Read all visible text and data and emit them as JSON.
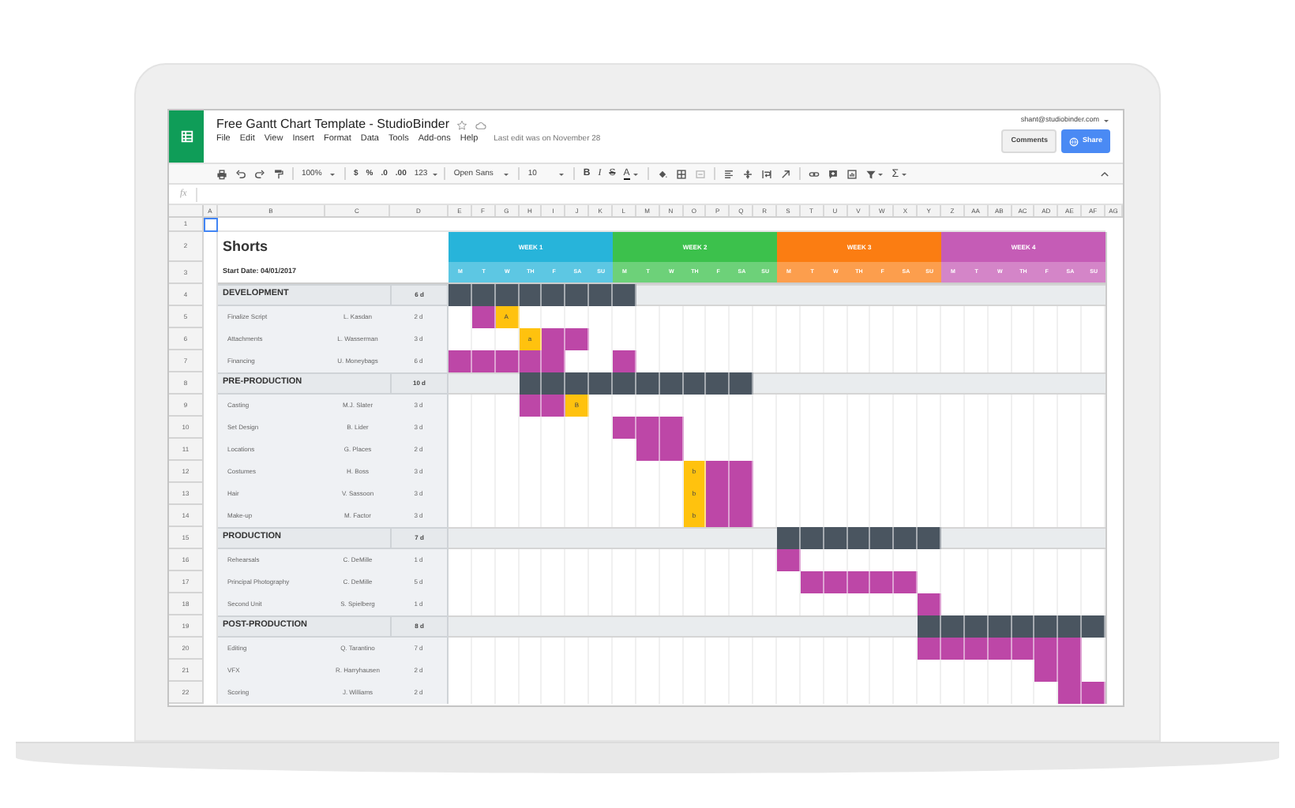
{
  "window": {
    "title": "Free Gantt Chart Template - StudioBinder",
    "account": "shant@studiobinder.com",
    "last_edit": "Last edit was on November 28"
  },
  "menu": [
    "File",
    "Edit",
    "View",
    "Insert",
    "Format",
    "Data",
    "Tools",
    "Add-ons",
    "Help"
  ],
  "buttons": {
    "comments": "Comments",
    "share": "Share"
  },
  "toolbar": {
    "zoom": "100%",
    "currency": "$",
    "percent": "%",
    "decimal_less": ".0",
    "decimal_more": ".00",
    "number_format": "123",
    "font": "Open Sans",
    "font_size": "10",
    "bold": "B",
    "italic": "I",
    "strikethrough": "S",
    "text_color": "A",
    "functions": "Σ"
  },
  "formula_bar": {
    "label": "fx"
  },
  "columns": [
    "A",
    "B",
    "C",
    "D",
    "E",
    "F",
    "G",
    "H",
    "I",
    "J",
    "K",
    "L",
    "M",
    "N",
    "O",
    "P",
    "Q",
    "R",
    "S",
    "T",
    "U",
    "V",
    "W",
    "X",
    "Y",
    "Z",
    "AA",
    "AB",
    "AC",
    "AD",
    "AE",
    "AF",
    "AG"
  ],
  "timeline": {
    "weeks": [
      {
        "label": "WEEK 1",
        "color": "#27b4da",
        "days": [
          "M",
          "T",
          "W",
          "TH",
          "F",
          "SA",
          "SU"
        ]
      },
      {
        "label": "WEEK 2",
        "color": "#3cc14c",
        "days": [
          "M",
          "T",
          "W",
          "TH",
          "F",
          "SA",
          "SU"
        ]
      },
      {
        "label": "WEEK 3",
        "color": "#fb7d12",
        "days": [
          "M",
          "T",
          "W",
          "TH",
          "F",
          "SA",
          "SU"
        ]
      },
      {
        "label": "WEEK 4",
        "color": "#c55cb6",
        "days": [
          "M",
          "T",
          "W",
          "TH",
          "F",
          "SA",
          "SU"
        ]
      }
    ]
  },
  "rows": [
    {
      "number": "1",
      "kind": "blank",
      "cell_selected": true
    },
    {
      "number": "2",
      "kind": "title",
      "text": "Shorts"
    },
    {
      "number": "3",
      "kind": "subtitle",
      "text": "Start Date: 04/01/2017"
    },
    {
      "number": "4",
      "kind": "phase",
      "name": "DEVELOPMENT",
      "duration": "6 d",
      "days": [
        true,
        true,
        true,
        true,
        true,
        true,
        true,
        true,
        false,
        false,
        false,
        false,
        false,
        false,
        false,
        false,
        false,
        false,
        false,
        false,
        false,
        false,
        false,
        false,
        false,
        false,
        false,
        false
      ]
    },
    {
      "number": "5",
      "kind": "task",
      "name": "Finalize Script",
      "owner": "L. Kasdan",
      "duration": "2 d",
      "days": [
        false,
        true,
        {
          "kind": "milestone",
          "label": "A"
        },
        false,
        false,
        false,
        false,
        false,
        false,
        false,
        false,
        false,
        false,
        false,
        false,
        false,
        false,
        false,
        false,
        false,
        false,
        false,
        false,
        false,
        false,
        false,
        false,
        false
      ]
    },
    {
      "number": "6",
      "kind": "task",
      "name": "Attachments",
      "owner": "L. Wasserman",
      "duration": "3 d",
      "days": [
        false,
        false,
        false,
        {
          "kind": "milestone",
          "label": "a"
        },
        true,
        true,
        false,
        false,
        false,
        false,
        false,
        false,
        false,
        false,
        false,
        false,
        false,
        false,
        false,
        false,
        false,
        false,
        false,
        false,
        false,
        false,
        false,
        false
      ]
    },
    {
      "number": "7",
      "kind": "task",
      "name": "Financing",
      "owner": "U. Moneybags",
      "duration": "6 d",
      "days": [
        true,
        true,
        true,
        true,
        true,
        false,
        false,
        true,
        false,
        false,
        false,
        false,
        false,
        false,
        false,
        false,
        false,
        false,
        false,
        false,
        false,
        false,
        false,
        false,
        false,
        false,
        false,
        false
      ]
    },
    {
      "number": "8",
      "kind": "phase",
      "name": "PRE-PRODUCTION",
      "duration": "10 d",
      "days": [
        false,
        false,
        false,
        true,
        true,
        true,
        true,
        true,
        true,
        true,
        true,
        true,
        true,
        false,
        false,
        false,
        false,
        false,
        false,
        false,
        false,
        false,
        false,
        false,
        false,
        false,
        false,
        false
      ]
    },
    {
      "number": "9",
      "kind": "task",
      "name": "Casting",
      "owner": "M.J. Slater",
      "duration": "3 d",
      "days": [
        false,
        false,
        false,
        true,
        true,
        {
          "kind": "milestone",
          "label": "B"
        },
        false,
        false,
        false,
        false,
        false,
        false,
        false,
        false,
        false,
        false,
        false,
        false,
        false,
        false,
        false,
        false,
        false,
        false,
        false,
        false,
        false,
        false
      ]
    },
    {
      "number": "10",
      "kind": "task",
      "name": "Set Design",
      "owner": "B. Lider",
      "duration": "3 d",
      "days": [
        false,
        false,
        false,
        false,
        false,
        false,
        false,
        true,
        true,
        true,
        false,
        false,
        false,
        false,
        false,
        false,
        false,
        false,
        false,
        false,
        false,
        false,
        false,
        false,
        false,
        false,
        false,
        false
      ]
    },
    {
      "number": "11",
      "kind": "task",
      "name": "Locations",
      "owner": "G. Places",
      "duration": "2 d",
      "days": [
        false,
        false,
        false,
        false,
        false,
        false,
        false,
        false,
        true,
        true,
        false,
        false,
        false,
        false,
        false,
        false,
        false,
        false,
        false,
        false,
        false,
        false,
        false,
        false,
        false,
        false,
        false,
        false
      ]
    },
    {
      "number": "12",
      "kind": "task",
      "name": "Costumes",
      "owner": "H. Boss",
      "duration": "3 d",
      "days": [
        false,
        false,
        false,
        false,
        false,
        false,
        false,
        false,
        false,
        false,
        {
          "kind": "milestone",
          "label": "b"
        },
        true,
        true,
        false,
        false,
        false,
        false,
        false,
        false,
        false,
        false,
        false,
        false,
        false,
        false,
        false,
        false,
        false
      ]
    },
    {
      "number": "13",
      "kind": "task",
      "name": "Hair",
      "owner": "V. Sassoon",
      "duration": "3 d",
      "days": [
        false,
        false,
        false,
        false,
        false,
        false,
        false,
        false,
        false,
        false,
        {
          "kind": "milestone",
          "label": "b"
        },
        true,
        true,
        false,
        false,
        false,
        false,
        false,
        false,
        false,
        false,
        false,
        false,
        false,
        false,
        false,
        false,
        false
      ]
    },
    {
      "number": "14",
      "kind": "task",
      "name": "Make-up",
      "owner": "M. Factor",
      "duration": "3 d",
      "days": [
        false,
        false,
        false,
        false,
        false,
        false,
        false,
        false,
        false,
        false,
        {
          "kind": "milestone",
          "label": "b"
        },
        true,
        true,
        false,
        false,
        false,
        false,
        false,
        false,
        false,
        false,
        false,
        false,
        false,
        false,
        false,
        false,
        false
      ]
    },
    {
      "number": "15",
      "kind": "phase",
      "name": "PRODUCTION",
      "duration": "7 d",
      "days": [
        false,
        false,
        false,
        false,
        false,
        false,
        false,
        false,
        false,
        false,
        false,
        false,
        false,
        false,
        true,
        true,
        true,
        true,
        true,
        true,
        true,
        false,
        false,
        false,
        false,
        false,
        false,
        false
      ]
    },
    {
      "number": "16",
      "kind": "task",
      "name": "Rehearsals",
      "owner": "C. DeMille",
      "duration": "1 d",
      "days": [
        false,
        false,
        false,
        false,
        false,
        false,
        false,
        false,
        false,
        false,
        false,
        false,
        false,
        false,
        true,
        false,
        false,
        false,
        false,
        false,
        false,
        false,
        false,
        false,
        false,
        false,
        false,
        false
      ]
    },
    {
      "number": "17",
      "kind": "task",
      "name": "Principal Photography",
      "owner": "C. DeMille",
      "duration": "5 d",
      "days": [
        false,
        false,
        false,
        false,
        false,
        false,
        false,
        false,
        false,
        false,
        false,
        false,
        false,
        false,
        false,
        true,
        true,
        true,
        true,
        true,
        false,
        false,
        false,
        false,
        false,
        false,
        false,
        false
      ]
    },
    {
      "number": "18",
      "kind": "task",
      "name": "Second Unit",
      "owner": "S. Spielberg",
      "duration": "1 d",
      "days": [
        false,
        false,
        false,
        false,
        false,
        false,
        false,
        false,
        false,
        false,
        false,
        false,
        false,
        false,
        false,
        false,
        false,
        false,
        false,
        false,
        true,
        false,
        false,
        false,
        false,
        false,
        false,
        false
      ]
    },
    {
      "number": "19",
      "kind": "phase",
      "name": "POST-PRODUCTION",
      "duration": "8 d",
      "days": [
        false,
        false,
        false,
        false,
        false,
        false,
        false,
        false,
        false,
        false,
        false,
        false,
        false,
        false,
        false,
        false,
        false,
        false,
        false,
        false,
        true,
        true,
        true,
        true,
        true,
        true,
        true,
        true
      ]
    },
    {
      "number": "20",
      "kind": "task",
      "name": "Editing",
      "owner": "Q. Tarantino",
      "duration": "7 d",
      "days": [
        false,
        false,
        false,
        false,
        false,
        false,
        false,
        false,
        false,
        false,
        false,
        false,
        false,
        false,
        false,
        false,
        false,
        false,
        false,
        false,
        true,
        true,
        true,
        true,
        true,
        true,
        true,
        false
      ]
    },
    {
      "number": "21",
      "kind": "task",
      "name": "VFX",
      "owner": "R. Harryhausen",
      "duration": "2 d",
      "days": [
        false,
        false,
        false,
        false,
        false,
        false,
        false,
        false,
        false,
        false,
        false,
        false,
        false,
        false,
        false,
        false,
        false,
        false,
        false,
        false,
        false,
        false,
        false,
        false,
        false,
        true,
        true,
        false
      ]
    },
    {
      "number": "22",
      "kind": "task",
      "name": "Scoring",
      "owner": "J. Williams",
      "duration": "2 d",
      "days": [
        false,
        false,
        false,
        false,
        false,
        false,
        false,
        false,
        false,
        false,
        false,
        false,
        false,
        false,
        false,
        false,
        false,
        false,
        false,
        false,
        false,
        false,
        false,
        false,
        false,
        false,
        true,
        true
      ]
    }
  ]
}
